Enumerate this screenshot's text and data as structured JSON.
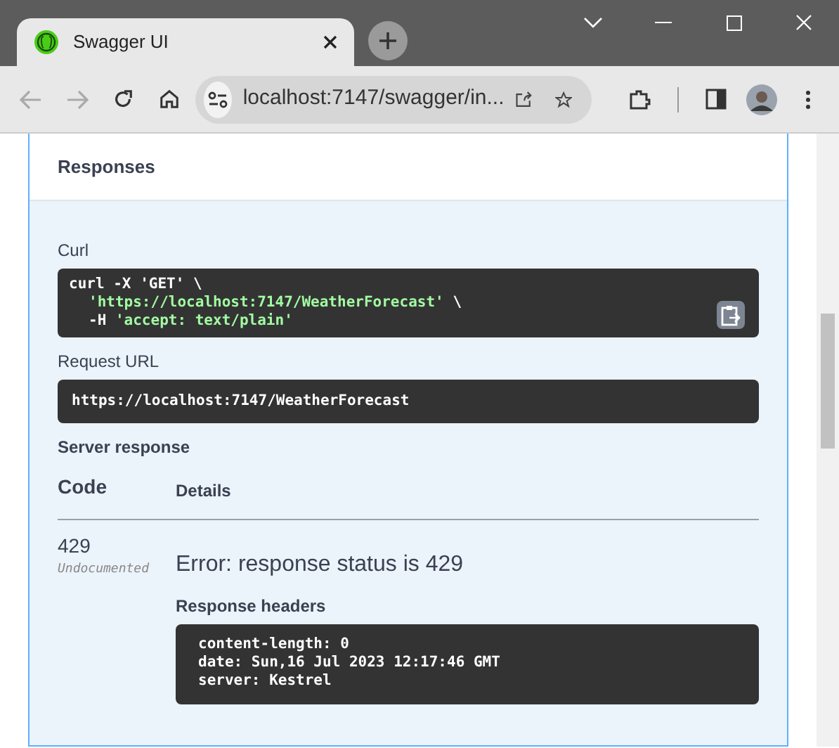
{
  "browser": {
    "tab_title": "Swagger UI",
    "address": "localhost:7147/swagger/in..."
  },
  "section_title": "Responses",
  "curl": {
    "label": "Curl",
    "lines": [
      {
        "indented": false,
        "tokens": [
          {
            "text": "curl -X 'GET' \\",
            "kind": "plain"
          }
        ]
      },
      {
        "indented": true,
        "tokens": [
          {
            "text": "'https://localhost:7147/WeatherForecast'",
            "kind": "string"
          },
          {
            "text": " \\",
            "kind": "plain"
          }
        ]
      },
      {
        "indented": true,
        "tokens": [
          {
            "text": "-H ",
            "kind": "plain"
          },
          {
            "text": "'accept: text/plain'",
            "kind": "string"
          }
        ]
      }
    ]
  },
  "request_url": {
    "label": "Request URL",
    "value": "https://localhost:7147/WeatherForecast"
  },
  "server_response": {
    "label": "Server response",
    "columns": [
      "Code",
      "Details"
    ],
    "rows": [
      {
        "code": "429",
        "note": "Undocumented",
        "error": "Error: response status is 429",
        "headers_label": "Response headers",
        "headers": [
          "content-length: 0",
          "date: Sun,16 Jul 2023 12:17:46 GMT",
          "server: Kestrel"
        ]
      }
    ]
  }
}
